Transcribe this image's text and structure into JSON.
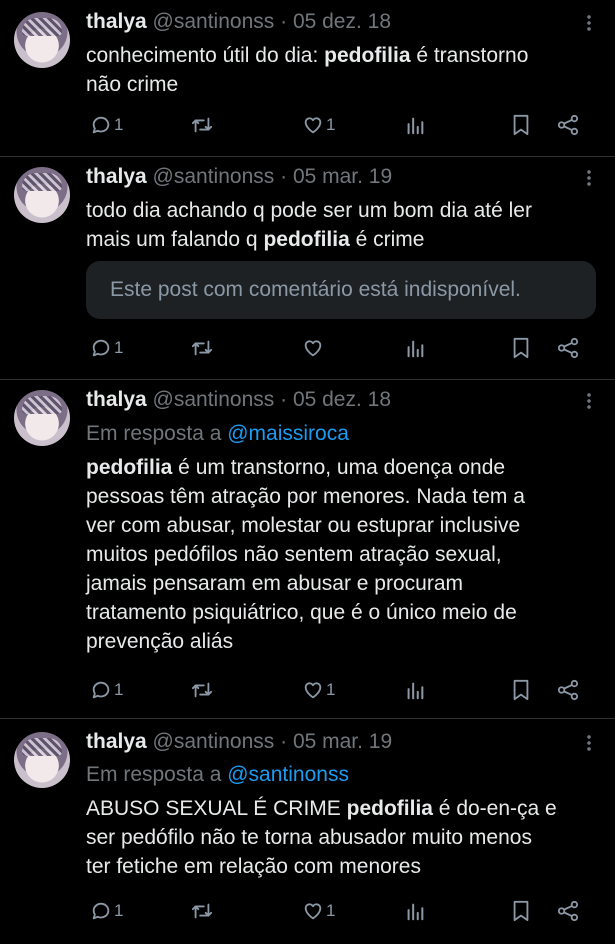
{
  "tweets": [
    {
      "name": "thalya",
      "handle": "@santinonss",
      "date": "05 dez. 18",
      "reply_prefix": "",
      "reply_to": "",
      "text_parts": [
        {
          "t": "conhecimento útil do dia: ",
          "b": false
        },
        {
          "t": "pedofilia",
          "b": true
        },
        {
          "t": " é transtorno\nnão crime",
          "b": false
        }
      ],
      "embed": "",
      "reply_count": "1",
      "like_count": "1"
    },
    {
      "name": "thalya",
      "handle": "@santinonss",
      "date": "05 mar. 19",
      "reply_prefix": "",
      "reply_to": "",
      "text_parts": [
        {
          "t": "todo dia achando q pode ser um bom dia até ler\nmais um falando q ",
          "b": false
        },
        {
          "t": "pedofilia",
          "b": true
        },
        {
          "t": " é crime",
          "b": false
        }
      ],
      "embed": "Este post com comentário está indisponível.",
      "reply_count": "1",
      "like_count": ""
    },
    {
      "name": "thalya",
      "handle": "@santinonss",
      "date": "05 dez. 18",
      "reply_prefix": "Em resposta a ",
      "reply_to": "@maissiroca",
      "text_parts": [
        {
          "t": "pedofilia",
          "b": true
        },
        {
          "t": " é um transtorno, uma doença onde\npessoas têm atração por menores. Nada tem a\nver com abusar, molestar ou estuprar inclusive\nmuitos pedófilos não sentem atração sexual,\njamais pensaram em abusar e procuram\ntratamento psiquiátrico, que é o único meio de\nprevenção aliás",
          "b": false
        }
      ],
      "embed": "",
      "reply_count": "1",
      "like_count": "1"
    },
    {
      "name": "thalya",
      "handle": "@santinonss",
      "date": "05 mar. 19",
      "reply_prefix": "Em resposta a ",
      "reply_to": "@santinonss",
      "text_parts": [
        {
          "t": "ABUSO SEXUAL É CRIME ",
          "b": false
        },
        {
          "t": "pedofilia",
          "b": true
        },
        {
          "t": " é do-en-ça e\nser pedófilo não te torna abusador muito menos\nter fetiche em relação com menores",
          "b": false
        }
      ],
      "embed": "",
      "reply_count": "1",
      "like_count": "1"
    }
  ],
  "separator": " · ",
  "icons": [
    "reply-icon",
    "retweet-icon",
    "like-icon",
    "views-icon",
    "bookmark-icon",
    "share-icon",
    "more-icon"
  ],
  "colors": {
    "background": "#000000",
    "text": "#e7e9ea",
    "muted": "#71767b",
    "mention": "#1d9bf0",
    "divider": "#2f3336",
    "embed_bg": "#1e2124"
  }
}
